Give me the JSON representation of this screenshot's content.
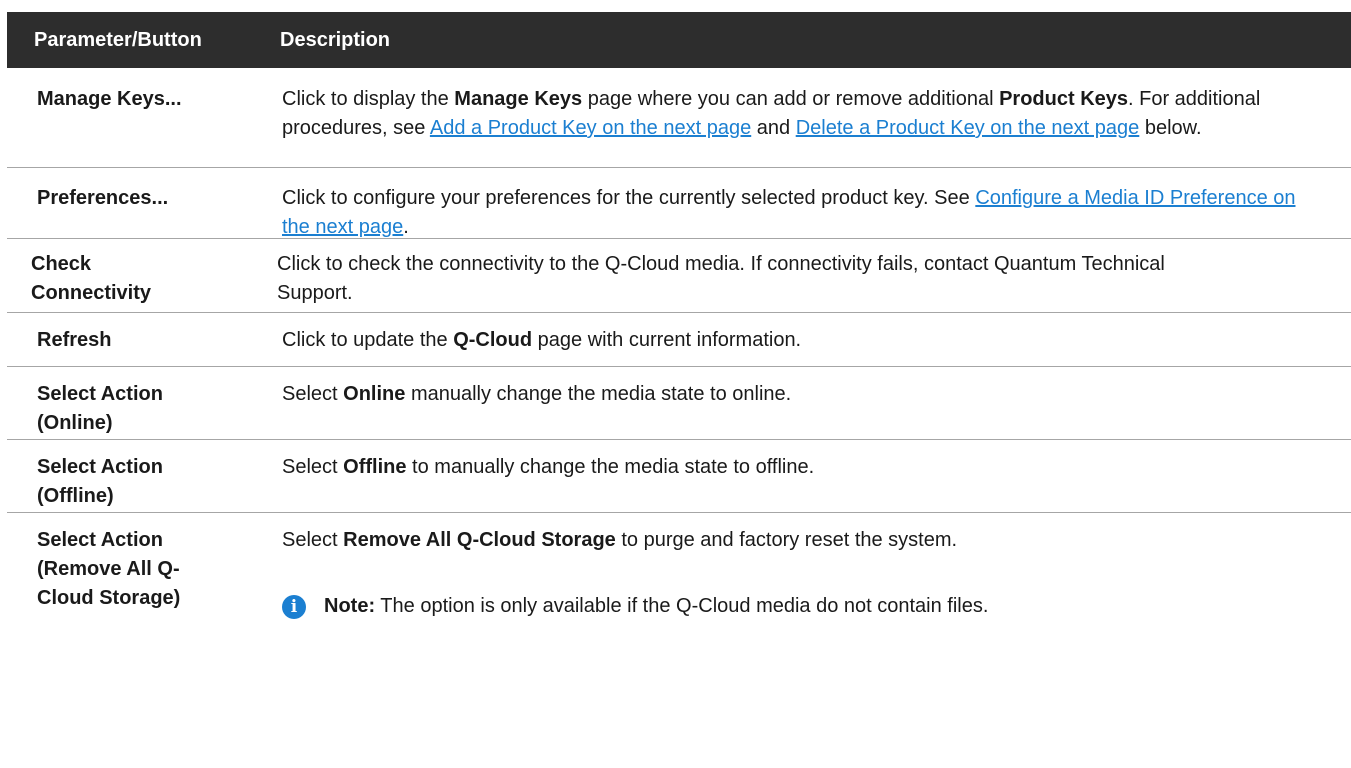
{
  "header": {
    "col1": "Parameter/Button",
    "col2": "Description"
  },
  "rows": [
    {
      "name": "Manage Keys...",
      "desc": [
        "Click to display the ",
        "Manage Keys",
        " page where you can add or remove additional ",
        "Product Keys",
        ". For additional procedures, see ",
        "Add a Product Key on the next page",
        " and ",
        "Delete a Product Key on the next page",
        " below."
      ]
    },
    {
      "name": "Preferences...",
      "desc": [
        "Click to configure your preferences for the currently selected product key. See ",
        "Configure a Media ID Preference on the next page",
        "."
      ]
    },
    {
      "name": "Check Connectivity",
      "desc": [
        "Click to check the connectivity to the Q-Cloud media. If connectivity fails, contact Quantum Technical Support."
      ]
    },
    {
      "name": "Refresh",
      "desc": [
        "Click to update the ",
        "Q-Cloud",
        " page with current information."
      ]
    },
    {
      "name": "Select Action (Online)",
      "desc": [
        "Select ",
        "Online",
        " manually change the media state to online."
      ]
    },
    {
      "name": "Select Action (Offline)",
      "desc": [
        "Select ",
        "Offline",
        " to manually change the media state to offline."
      ]
    },
    {
      "name": "Select Action (Remove All Q-Cloud Storage)",
      "desc": [
        "Select ",
        "Remove All Q-Cloud Storage",
        " to purge and factory reset the system."
      ],
      "note": {
        "label": "Note:",
        "text": " The option is only available if the Q-Cloud media do not contain files.",
        "icon": "info-icon"
      }
    }
  ],
  "colors": {
    "header_bg": "#2d2d2d",
    "link": "#1b7fd1",
    "divider": "#a6a6a6"
  }
}
